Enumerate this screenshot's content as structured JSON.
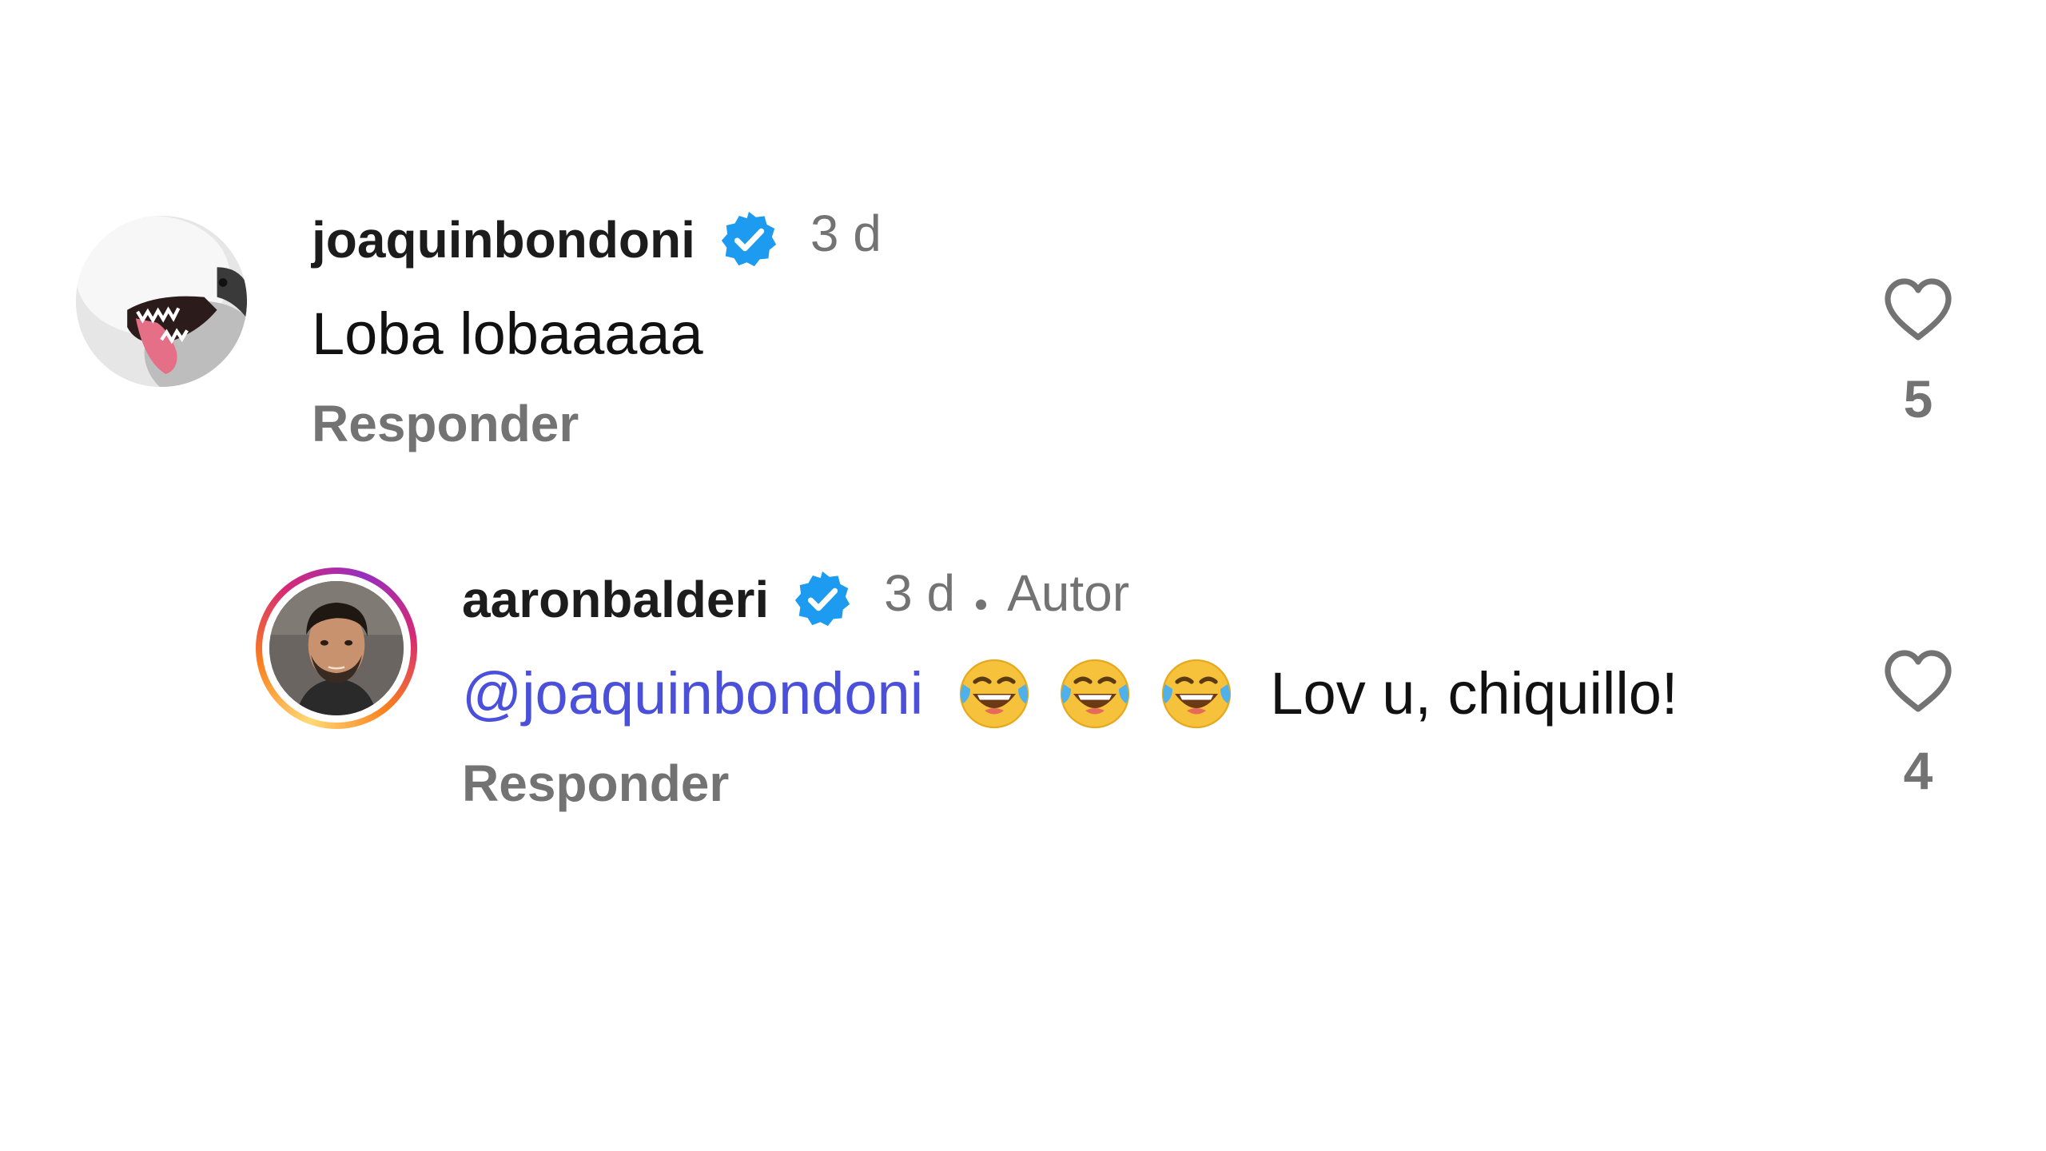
{
  "comments": [
    {
      "username": "joaquinbondoni",
      "time": "3 d",
      "text": "Loba lobaaaaa",
      "reply_label": "Responder",
      "likes": "5"
    },
    {
      "username": "aaronbalderi",
      "time": "3 d",
      "author_label": "Autor",
      "mention": "@joaquinbondoni",
      "text_after": "Lov u, chiquillo!",
      "reply_label": "Responder",
      "likes": "4"
    }
  ],
  "colors": {
    "verified": "#1d9bf0",
    "mention": "#4a50d9",
    "muted": "#737373"
  }
}
